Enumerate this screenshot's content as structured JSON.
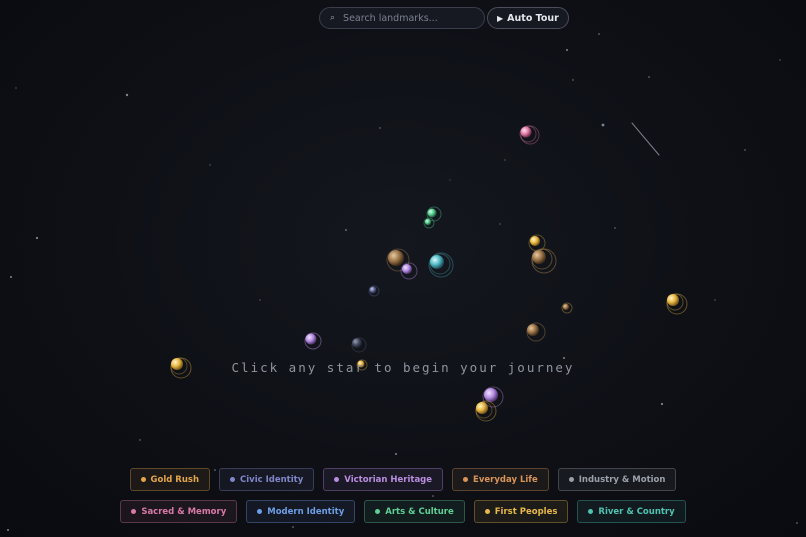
{
  "search": {
    "placeholder": "Search landmarks...",
    "icon": "search-icon"
  },
  "tour": {
    "label": "Auto Tour",
    "icon": "play-icon"
  },
  "prompt": "Click any star to begin your journey",
  "categories_row1": [
    {
      "label": "Gold Rush",
      "color": "#e3a64a"
    },
    {
      "label": "Civic Identity",
      "color": "#7f86c9"
    },
    {
      "label": "Victorian Heritage",
      "color": "#b98de0"
    },
    {
      "label": "Everyday Life",
      "color": "#d8955a"
    },
    {
      "label": "Industry & Motion",
      "color": "#9aa0aa"
    }
  ],
  "categories_row2": [
    {
      "label": "Sacred & Memory",
      "color": "#d97aa6"
    },
    {
      "label": "Modern Identity",
      "color": "#6e9ee6"
    },
    {
      "label": "Arts & Culture",
      "color": "#5fcf94"
    },
    {
      "label": "First Peoples",
      "color": "#e6b94a"
    },
    {
      "label": "River & Country",
      "color": "#4fc2b0"
    }
  ]
}
